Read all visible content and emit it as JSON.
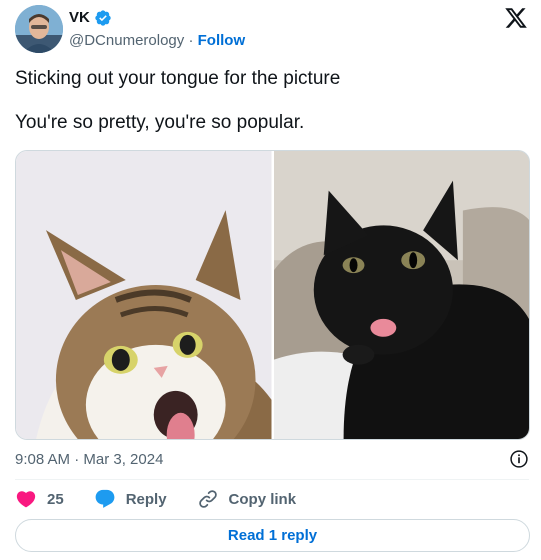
{
  "author": {
    "display_name": "VK",
    "handle": "@DCnumerology",
    "separator": " · ",
    "follow_label": "Follow"
  },
  "tweet": {
    "lines": [
      "Sticking out your tongue for the picture",
      "You're so pretty, you're so popular."
    ],
    "timestamp": "9:08 AM · Mar 3, 2024"
  },
  "actions": {
    "like_count": "25",
    "reply_label": "Reply",
    "copy_link_label": "Copy link"
  },
  "read_replies_label": "Read 1 reply",
  "colors": {
    "accent": "#006fd6",
    "like": "#f91880",
    "verified": "#1d9bf0",
    "muted_text": "#536471",
    "border": "#cfd9de"
  },
  "icons": [
    "verified-badge-icon",
    "x-logo-icon",
    "info-icon",
    "heart-icon",
    "reply-bubble-icon",
    "link-icon"
  ]
}
